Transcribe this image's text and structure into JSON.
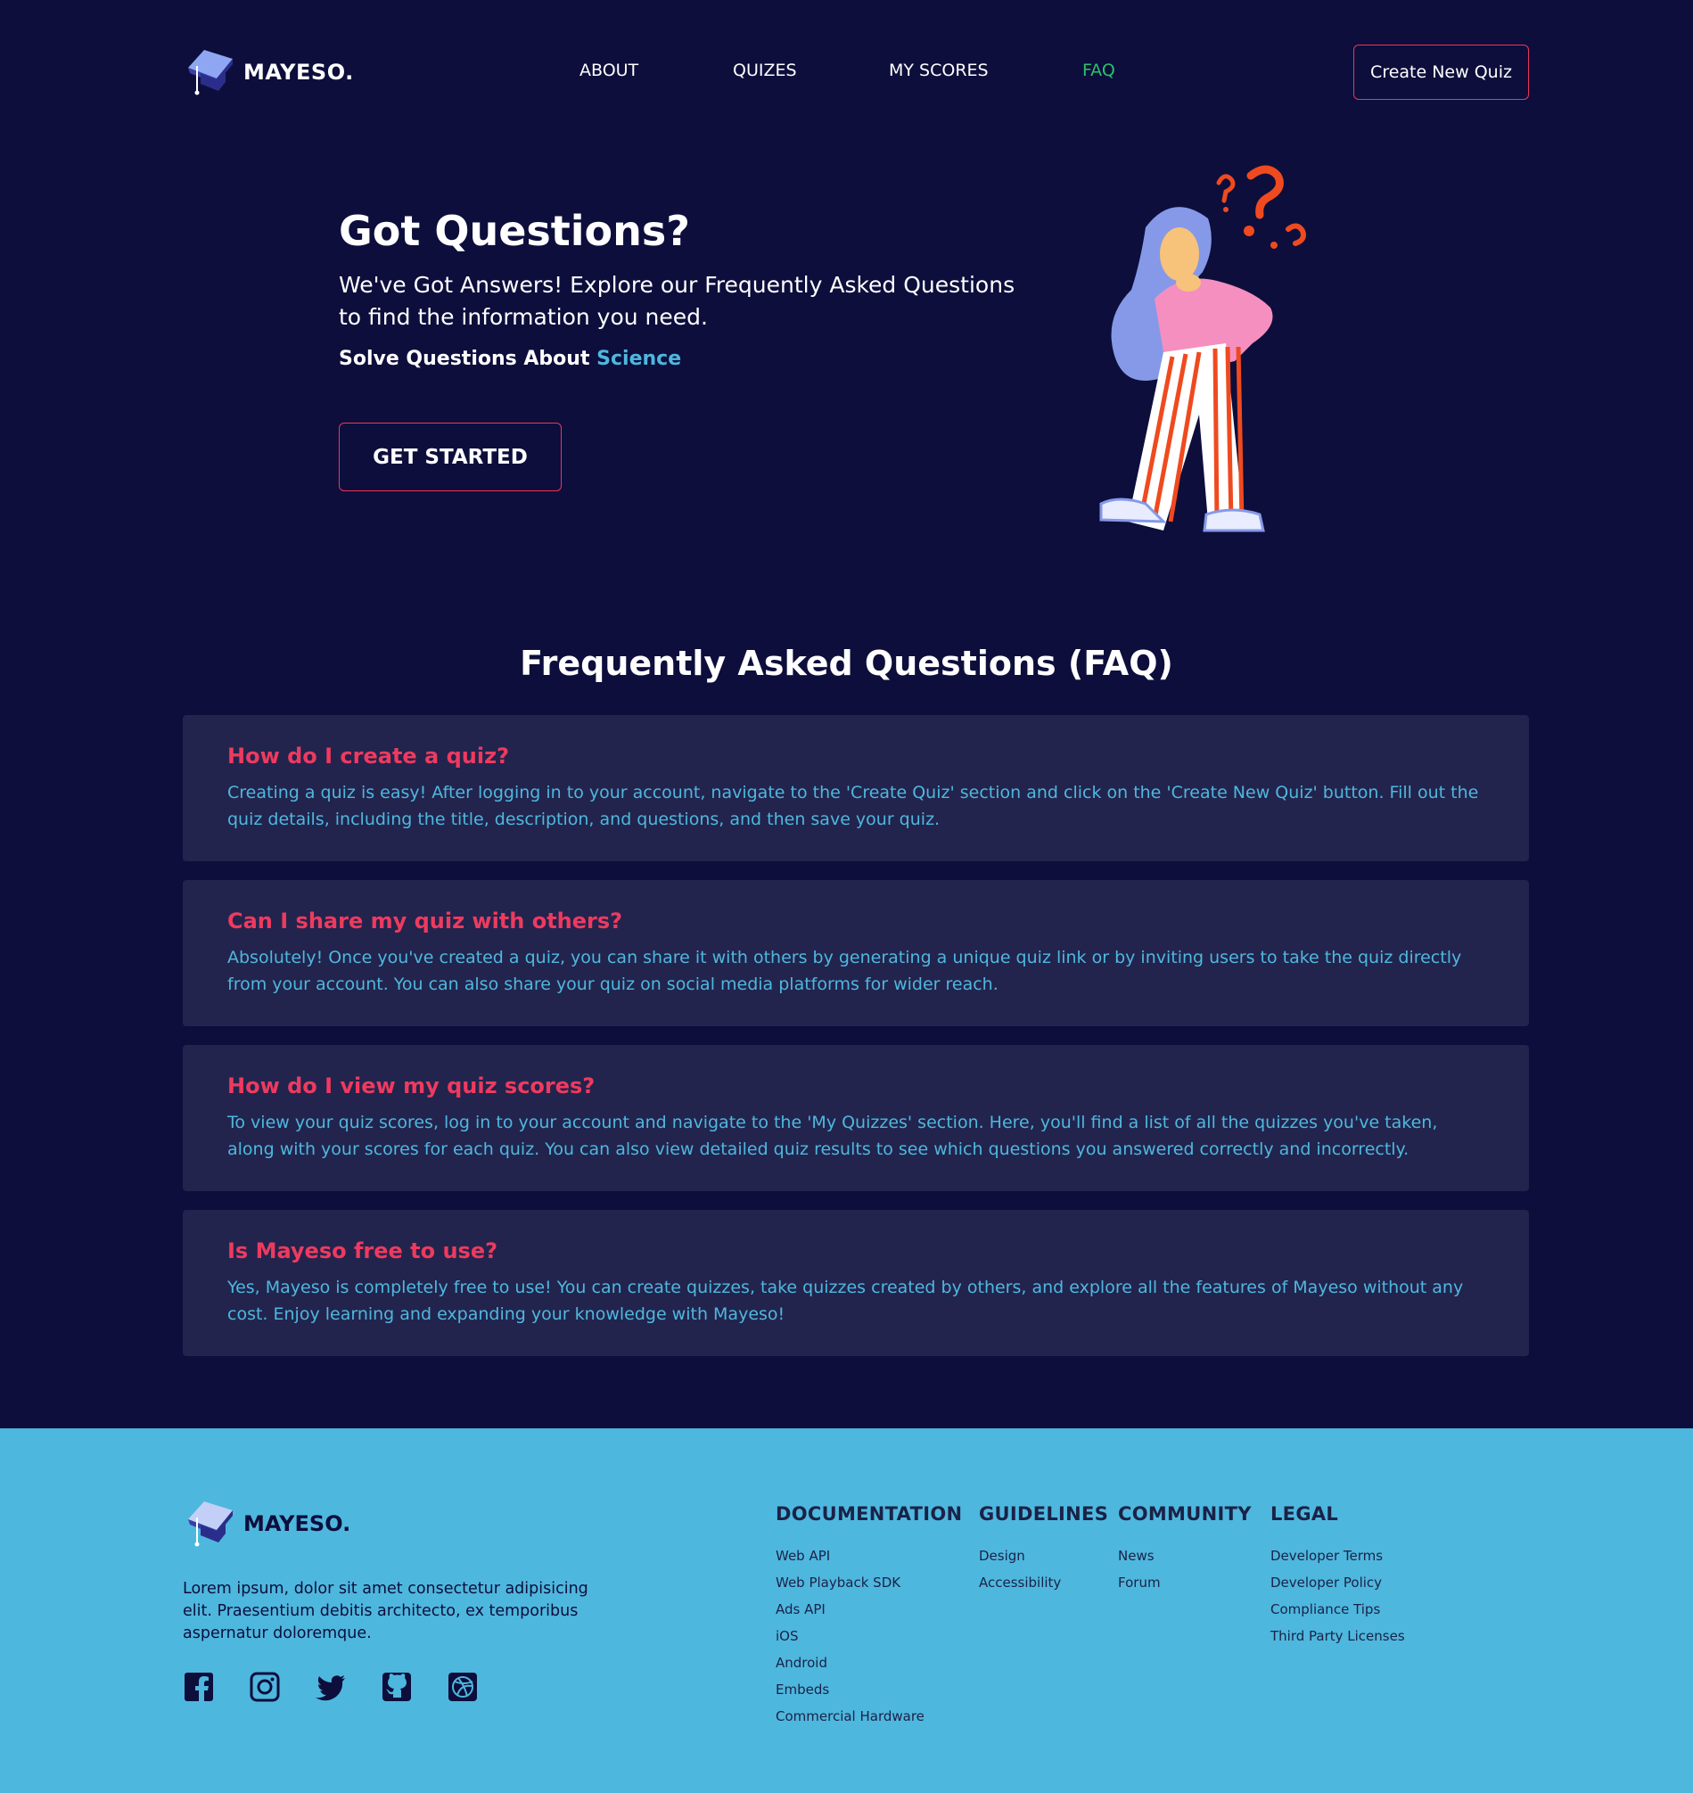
{
  "brand": {
    "name": "MAYESO."
  },
  "nav": {
    "items": [
      {
        "label": "ABOUT"
      },
      {
        "label": "QUIZES"
      },
      {
        "label": "MY SCORES"
      },
      {
        "label": "FAQ",
        "active": true
      }
    ],
    "cta_label": "Create New Quiz"
  },
  "hero": {
    "title": "Got Questions?",
    "subtitle": "We've Got Answers! Explore our Frequently Asked Questions to find the information you need.",
    "line_prefix": "Solve Questions About",
    "line_accent": "Science",
    "button_label": "GET STARTED"
  },
  "faq": {
    "title": "Frequently Asked Questions (FAQ)",
    "items": [
      {
        "question": "How do I create a quiz?",
        "answer": "Creating a quiz is easy! After logging in to your account, navigate to the 'Create Quiz' section and click on the 'Create New Quiz' button. Fill out the quiz details, including the title, description, and questions, and then save your quiz."
      },
      {
        "question": "Can I share my quiz with others?",
        "answer": "Absolutely! Once you've created a quiz, you can share it with others by generating a unique quiz link or by inviting users to take the quiz directly from your account. You can also share your quiz on social media platforms for wider reach."
      },
      {
        "question": "How do I view my quiz scores?",
        "answer": "To view your quiz scores, log in to your account and navigate to the 'My Quizzes' section. Here, you'll find a list of all the quizzes you've taken, along with your scores for each quiz. You can also view detailed quiz results to see which questions you answered correctly and incorrectly."
      },
      {
        "question": "Is Mayeso free to use?",
        "answer": "Yes, Mayeso is completely free to use! You can create quizzes, take quizzes created by others, and explore all the features of Mayeso without any cost. Enjoy learning and expanding your knowledge with Mayeso!"
      }
    ]
  },
  "footer": {
    "brand": "MAYESO.",
    "description": "Lorem ipsum, dolor sit amet consectetur adipisicing elit. Praesentium debitis architecto, ex temporibus aspernatur doloremque.",
    "socials": [
      "facebook-icon",
      "instagram-icon",
      "twitter-icon",
      "github-icon",
      "dribbble-icon"
    ],
    "columns": [
      {
        "title": "DOCUMENTATION",
        "links": [
          "Web API",
          "Web Playback SDK",
          "Ads API",
          "iOS",
          "Android",
          "Embeds",
          "Commercial Hardware"
        ]
      },
      {
        "title": "GUIDELINES",
        "links": [
          "Design",
          "Accessibility"
        ]
      },
      {
        "title": "COMMUNITY",
        "links": [
          "News",
          "Forum"
        ]
      },
      {
        "title": "LEGAL",
        "links": [
          "Developer Terms",
          "Developer Policy",
          "Compliance Tips",
          "Third Party Licenses"
        ]
      }
    ]
  },
  "colors": {
    "background": "#0d0e3c",
    "accent_red": "#ee3a5f",
    "accent_blue": "#4fb7de",
    "active_nav": "#2bc16b",
    "card": "#22244d",
    "footer": "#4eb7de"
  }
}
